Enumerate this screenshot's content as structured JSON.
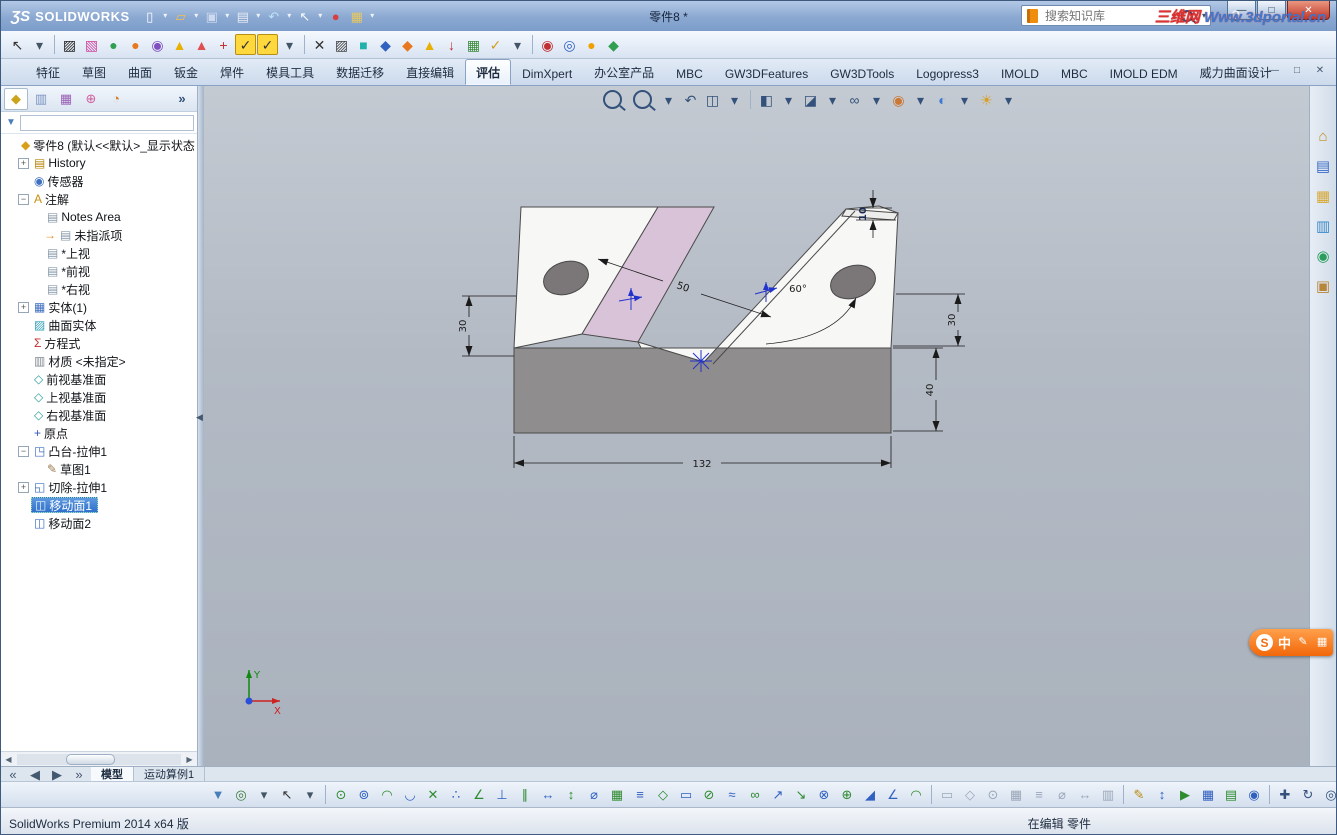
{
  "window": {
    "brand_mark": "ƷS",
    "brand_name": "SOLIDWORKS",
    "title": "零件8 *",
    "search_placeholder": "搜索知识库",
    "help_label": "?",
    "controls": {
      "minimize": "—",
      "maximize": "□",
      "close": "✕"
    },
    "doc_controls": {
      "minimize": "—",
      "restore": "□",
      "close": "✕"
    },
    "collapse_glyph": "◀"
  },
  "colors": {
    "titlebar": "#8aa8d1",
    "viewport_bg": "#b3bac4",
    "selection_blue": "#2e6fc9",
    "ime_orange": "#f2670a"
  },
  "titlebar_icons": [
    {
      "n": "new-document-icon",
      "g": "▯",
      "c": "#fbfdff"
    },
    {
      "n": "new-dropdown-icon",
      "g": "▾",
      "cls": "dd",
      "c": "#eef3fa"
    },
    {
      "n": "open-icon",
      "g": "▱",
      "c": "#f2c14e"
    },
    {
      "n": "open-dropdown-icon",
      "g": "▾",
      "cls": "dd",
      "c": "#eef3fa"
    },
    {
      "n": "save-icon",
      "g": "▣",
      "c": "#cdd9ee"
    },
    {
      "n": "save-dropdown-icon",
      "g": "▾",
      "cls": "dd",
      "c": "#eef3fa"
    },
    {
      "n": "print-icon",
      "g": "▤",
      "c": "#e6ebf3"
    },
    {
      "n": "print-dropdown-icon",
      "g": "▾",
      "cls": "dd",
      "c": "#eef3fa"
    },
    {
      "n": "undo-icon",
      "g": "↶",
      "c": "#bfe3f7"
    },
    {
      "n": "undo-dropdown-icon",
      "g": "▾",
      "cls": "dd",
      "c": "#eef3fa"
    },
    {
      "n": "select-cursor-icon",
      "g": "↖",
      "c": "#f7fafc"
    },
    {
      "n": "select-dropdown-icon",
      "g": "▾",
      "cls": "dd",
      "c": "#eef3fa"
    },
    {
      "n": "rebuild-icon",
      "g": "●",
      "c": "#d84040"
    },
    {
      "n": "options-icon",
      "g": "▦",
      "c": "#e8c860"
    },
    {
      "n": "options-dropdown-icon",
      "g": "▾",
      "cls": "dd",
      "c": "#eef3fa"
    }
  ],
  "toolbar2_icons": [
    {
      "n": "select-tool-icon",
      "g": "↖",
      "c": "#333"
    },
    {
      "n": "select-dropdown-icon",
      "g": "▾",
      "cls": "dd",
      "c": "#456"
    },
    {
      "cls": "sep"
    },
    {
      "n": "zebra-stripes-icon",
      "g": "▨",
      "c": "#222"
    },
    {
      "n": "draft-analysis-icon",
      "g": "▧",
      "c": "#d048a0"
    },
    {
      "n": "curvature-icon",
      "g": "●",
      "c": "#30a050"
    },
    {
      "n": "appearance-ball-icon",
      "g": "●",
      "c": "#e87820"
    },
    {
      "n": "sphere-check-icon",
      "g": "◉",
      "c": "#8050c0"
    },
    {
      "n": "warning-flag-icon",
      "g": "▲",
      "c": "#e8b000"
    },
    {
      "n": "error-flag-icon",
      "g": "▲",
      "c": "#e05050"
    },
    {
      "n": "add-symbol-icon",
      "g": "+",
      "c": "#c03030"
    },
    {
      "n": "check-feature-icon",
      "g": "✓",
      "b": "#ffd83d",
      "c": "#333",
      "cls": "chk"
    },
    {
      "n": "check-sketch-icon",
      "g": "✓",
      "b": "#ffd83d",
      "c": "#333",
      "cls": "chk"
    },
    {
      "n": "check-dropdown-icon",
      "g": "▾",
      "cls": "dd",
      "c": "#456"
    },
    {
      "cls": "sep"
    },
    {
      "n": "deviation-icon",
      "g": "✕",
      "c": "#333"
    },
    {
      "n": "zebra2-icon",
      "g": "▨",
      "c": "#444"
    },
    {
      "n": "thickness-icon",
      "g": "■",
      "c": "#20b2aa"
    },
    {
      "n": "measure-icon",
      "g": "◆",
      "c": "#3060c0"
    },
    {
      "n": "mass-props-icon",
      "g": "◆",
      "c": "#e87820"
    },
    {
      "n": "sensor-warning-icon",
      "g": "▲",
      "c": "#e8b000"
    },
    {
      "n": "import-diag-icon",
      "g": "↓",
      "c": "#c03030"
    },
    {
      "n": "stats-icon",
      "g": "▦",
      "c": "#3a8a3a"
    },
    {
      "n": "verify-icon",
      "g": "✓",
      "c": "#d0a020"
    },
    {
      "n": "verify-dropdown-icon",
      "g": "▾",
      "cls": "dd",
      "c": "#456"
    },
    {
      "cls": "sep"
    },
    {
      "n": "simulation-icon",
      "g": "◉",
      "c": "#c03030"
    },
    {
      "n": "flow-icon",
      "g": "◎",
      "c": "#3060c0"
    },
    {
      "n": "costing-icon",
      "g": "●",
      "c": "#f0a000"
    },
    {
      "n": "sustainability-icon",
      "g": "◆",
      "c": "#30a050"
    }
  ],
  "ribbon": {
    "tabs": [
      {
        "id": "features",
        "label": "特征"
      },
      {
        "id": "sketch",
        "label": "草图"
      },
      {
        "id": "surfaces",
        "label": "曲面"
      },
      {
        "id": "sheet-metal",
        "label": "钣金"
      },
      {
        "id": "weldments",
        "label": "焊件"
      },
      {
        "id": "mold-tools",
        "label": "模具工具"
      },
      {
        "id": "data-migration",
        "label": "数据迁移"
      },
      {
        "id": "direct-editing",
        "label": "直接编辑"
      },
      {
        "id": "evaluate",
        "label": "评估",
        "active": true
      },
      {
        "id": "dimxpert",
        "label": "DimXpert"
      },
      {
        "id": "office-products",
        "label": "办公室产品"
      },
      {
        "id": "mbc",
        "label": "MBC"
      },
      {
        "id": "gw3dfeatures",
        "label": "GW3DFeatures"
      },
      {
        "id": "gw3dtools",
        "label": "GW3DTools"
      },
      {
        "id": "logopress3",
        "label": "Logopress3"
      },
      {
        "id": "imold",
        "label": "IMOLD"
      },
      {
        "id": "mbc-2",
        "label": "MBC"
      },
      {
        "id": "imold-edm",
        "label": "IMOLD EDM"
      },
      {
        "id": "power-surfacing",
        "label": "威力曲面设计"
      }
    ]
  },
  "panel_tabs": [
    {
      "n": "featuremanager-tab-icon",
      "g": "◆",
      "c": "#caa41a",
      "cls": "active"
    },
    {
      "n": "propertymanager-tab-icon",
      "g": "▥",
      "c": "#7a93c0"
    },
    {
      "n": "configurationmanager-tab-icon",
      "g": "▦",
      "c": "#9a5fb5"
    },
    {
      "n": "dimxpertmanager-tab-icon",
      "g": "⊕",
      "c": "#d05fa0"
    },
    {
      "n": "displaymanager-tab-icon",
      "g": "◔",
      "c": "#d07f2a"
    },
    {
      "n": "panel-overflow-chevron-icon",
      "g": "»",
      "c": "#33517a",
      "cls": "chev"
    }
  ],
  "tree": {
    "items": [
      {
        "label": "零件8 (默认<<默认>_显示状态",
        "level": 0,
        "g": "◆",
        "c": "#d8a018",
        "exp": "none",
        "n": "part-icon"
      },
      {
        "label": "History",
        "level": 1,
        "g": "▤",
        "c": "#b8860b",
        "exp": "plus",
        "n": "history-folder-icon"
      },
      {
        "label": "传感器",
        "level": 1,
        "g": "◉",
        "c": "#3f6fbf",
        "exp": "none",
        "n": "sensors-icon"
      },
      {
        "label": "注解",
        "level": 1,
        "g": "A",
        "c": "#c89010",
        "exp": "minus",
        "n": "annotations-icon"
      },
      {
        "label": "Notes Area",
        "level": 2,
        "g": "▤",
        "c": "#8899aa",
        "exp": "none",
        "n": "notes-area-icon"
      },
      {
        "label": "未指派项",
        "level": 2,
        "g": "▤",
        "c": "#8899aa",
        "exp": "none",
        "arrow": true,
        "n": "unassigned-notes-icon"
      },
      {
        "label": "*上视",
        "level": 2,
        "g": "▤",
        "c": "#8899aa",
        "exp": "none",
        "n": "top-view-note-icon"
      },
      {
        "label": "*前视",
        "level": 2,
        "g": "▤",
        "c": "#8899aa",
        "exp": "none",
        "n": "front-view-note-icon"
      },
      {
        "label": "*右视",
        "level": 2,
        "g": "▤",
        "c": "#8899aa",
        "exp": "none",
        "n": "right-view-note-icon"
      },
      {
        "label": "实体(1)",
        "level": 1,
        "g": "▦",
        "c": "#3f6fbf",
        "exp": "plus",
        "n": "solid-bodies-folder-icon"
      },
      {
        "label": "曲面实体",
        "level": 1,
        "g": "▨",
        "c": "#30a0b8",
        "exp": "none",
        "n": "surface-bodies-folder-icon"
      },
      {
        "label": "方程式",
        "level": 1,
        "g": "Σ",
        "c": "#c03030",
        "exp": "none",
        "n": "equations-icon"
      },
      {
        "label": "材质 <未指定>",
        "level": 1,
        "g": "▥",
        "c": "#808890",
        "exp": "none",
        "n": "material-icon"
      },
      {
        "label": "前视基准面",
        "level": 1,
        "g": "◇",
        "c": "#2f9f9f",
        "exp": "none",
        "n": "front-plane-icon"
      },
      {
        "label": "上视基准面",
        "level": 1,
        "g": "◇",
        "c": "#2f9f9f",
        "exp": "none",
        "n": "top-plane-icon"
      },
      {
        "label": "右视基准面",
        "level": 1,
        "g": "◇",
        "c": "#2f9f9f",
        "exp": "none",
        "n": "right-plane-icon"
      },
      {
        "label": "原点",
        "level": 1,
        "g": "+",
        "c": "#3355bb",
        "exp": "none",
        "n": "origin-icon"
      },
      {
        "label": "凸台-拉伸1",
        "level": 1,
        "g": "◳",
        "c": "#3f6fbf",
        "exp": "minus",
        "n": "boss-extrude-icon"
      },
      {
        "label": "草图1",
        "level": 2,
        "g": "✎",
        "c": "#9a7b4f",
        "exp": "none",
        "n": "sketch-icon"
      },
      {
        "label": "切除-拉伸1",
        "level": 1,
        "g": "◱",
        "c": "#3f6fbf",
        "exp": "plus",
        "n": "cut-extrude-icon"
      },
      {
        "label": "移动面1",
        "level": 1,
        "g": "◫",
        "c": "#3f6fbf",
        "exp": "none",
        "selected": true,
        "n": "move-face-icon"
      },
      {
        "label": "移动面2",
        "level": 1,
        "g": "◫",
        "c": "#3f6fbf",
        "exp": "none",
        "n": "move-face-icon"
      }
    ]
  },
  "headsup_icons": [
    {
      "n": "zoom-fit-icon",
      "cls": "mag"
    },
    {
      "n": "zoom-area-icon",
      "cls": "mag"
    },
    {
      "n": "zoom-dropdown-icon",
      "g": "▾",
      "cls": "dd",
      "c": "#33517a"
    },
    {
      "n": "previous-view-icon",
      "g": "↶",
      "c": "#33517a"
    },
    {
      "n": "section-view-icon",
      "g": "◫",
      "c": "#33517a"
    },
    {
      "n": "section-dropdown-icon",
      "g": "▾",
      "cls": "dd",
      "c": "#33517a"
    },
    {
      "cls": "sep"
    },
    {
      "n": "view-orientation-icon",
      "g": "◧",
      "c": "#33517a"
    },
    {
      "n": "orientation-dropdown-icon",
      "g": "▾",
      "cls": "dd",
      "c": "#33517a"
    },
    {
      "n": "display-style-icon",
      "g": "◪",
      "c": "#33517a"
    },
    {
      "n": "display-dropdown-icon",
      "g": "▾",
      "cls": "dd",
      "c": "#33517a"
    },
    {
      "n": "hide-show-items-icon",
      "g": "∞",
      "c": "#33517a"
    },
    {
      "n": "hideshow-dropdown-icon",
      "g": "▾",
      "cls": "dd",
      "c": "#33517a"
    },
    {
      "n": "edit-appearance-icon",
      "g": "◉",
      "c": "#cc7733"
    },
    {
      "n": "appearance-dropdown-icon",
      "g": "▾",
      "cls": "dd",
      "c": "#33517a"
    },
    {
      "n": "apply-scene-icon",
      "g": "◐",
      "c": "#3a7ad0"
    },
    {
      "n": "scene-dropdown-icon",
      "g": "▾",
      "cls": "dd",
      "c": "#33517a"
    },
    {
      "n": "view-settings-icon",
      "g": "☀",
      "c": "#d8a020"
    },
    {
      "n": "viewsettings-dropdown-icon",
      "g": "▾",
      "cls": "dd",
      "c": "#33517a"
    }
  ],
  "right_strip_icons": [
    {
      "n": "solidworks-resources-icon",
      "g": "⌂",
      "c": "#c78c1e"
    },
    {
      "n": "design-library-icon",
      "g": "▤",
      "c": "#3a6bc9"
    },
    {
      "n": "file-explorer-icon",
      "g": "▦",
      "c": "#d8a832"
    },
    {
      "n": "view-palette-icon",
      "g": "▥",
      "c": "#3a8bc9"
    },
    {
      "n": "appearances-scenes-icon",
      "g": "◉",
      "c": "#2a9d5c"
    },
    {
      "n": "custom-properties-icon",
      "g": "▣",
      "c": "#b8863a"
    }
  ],
  "viewport": {
    "dims": {
      "width": "132",
      "left_height": "30",
      "slot": "50",
      "angle": "60°",
      "right_upper": "30",
      "right_lower": "40",
      "step": "10"
    },
    "triad": {
      "x_label": "X",
      "y_label": "Y"
    }
  },
  "model": {
    "face_white": "#f7f7f6",
    "face_dark": "#8f8d8e",
    "face_highlight": "#d9c3d8",
    "hole": "#7b7778",
    "edge": "#4a4a4a",
    "dimension": "#1a1a1a",
    "sketch_accent": "#2233cc"
  },
  "bottom_tabs": {
    "nav_icons": [
      {
        "n": "scroll-first-icon",
        "g": "«",
        "c": "#44586f"
      },
      {
        "n": "scroll-prev-icon",
        "g": "◀",
        "c": "#44586f"
      },
      {
        "n": "scroll-next-icon",
        "g": "▶",
        "c": "#44586f"
      },
      {
        "n": "scroll-last-icon",
        "g": "»",
        "c": "#44586f"
      }
    ],
    "tabs": [
      {
        "id": "model",
        "label": "模型",
        "active": true
      },
      {
        "id": "motion-study-1",
        "label": "运动算例1"
      }
    ]
  },
  "bottom_toolbar_icons": [
    {
      "n": "selection-filter-icon",
      "g": "▼",
      "c": "#4a7ebb"
    },
    {
      "n": "filter-magnify-icon",
      "g": "◎",
      "c": "#3a7a3a"
    },
    {
      "n": "filter-dropdown-icon",
      "g": "▾",
      "cls": "dd",
      "c": "#456"
    },
    {
      "n": "select-tool-icon",
      "g": "↖",
      "c": "#333"
    },
    {
      "n": "select-dropdown-icon",
      "g": "▾",
      "cls": "dd",
      "c": "#456"
    },
    {
      "cls": "sep"
    },
    {
      "n": "snap-point-icon",
      "g": "⊙",
      "c": "#2e8b2e"
    },
    {
      "n": "snap-center-icon",
      "g": "⊚",
      "c": "#3060c0"
    },
    {
      "n": "snap-arc-icon",
      "g": "◠",
      "c": "#2e8b2e"
    },
    {
      "n": "snap-quadrant-icon",
      "g": "◡",
      "c": "#3060c0"
    },
    {
      "n": "snap-intersection-icon",
      "g": "✕",
      "c": "#2e8b2e"
    },
    {
      "n": "snap-nearest-icon",
      "g": "∴",
      "c": "#3060c0"
    },
    {
      "n": "snap-angle-icon",
      "g": "∠",
      "c": "#2e8b2e"
    },
    {
      "n": "snap-perpendicular-icon",
      "g": "⊥",
      "c": "#3060c0"
    },
    {
      "n": "snap-parallel-icon",
      "g": "∥",
      "c": "#2e8b2e"
    },
    {
      "n": "snap-horizontal-icon",
      "g": "↔",
      "c": "#3060c0"
    },
    {
      "n": "snap-vertical-icon",
      "g": "↕",
      "c": "#2e8b2e"
    },
    {
      "n": "snap-diameter-icon",
      "g": "⌀",
      "c": "#3060c0"
    },
    {
      "n": "snap-grid-icon",
      "g": "▦",
      "c": "#2e8b2e"
    },
    {
      "n": "snap-length-icon",
      "g": "≡",
      "c": "#3060c0"
    },
    {
      "n": "snap-shape-icon",
      "g": "◇",
      "c": "#2e8b2e"
    },
    {
      "n": "snap-rect-icon",
      "g": "▭",
      "c": "#3060c0"
    },
    {
      "n": "snap-slot-icon",
      "g": "⊘",
      "c": "#2e8b2e"
    },
    {
      "n": "snap-spline-icon",
      "g": "≈",
      "c": "#3060c0"
    },
    {
      "n": "snap-infinite-icon",
      "g": "∞",
      "c": "#2e8b2e"
    },
    {
      "n": "dim-smart-icon",
      "g": "↗",
      "c": "#3060c0"
    },
    {
      "n": "dim-horizontal-icon",
      "g": "↘",
      "c": "#2e8b2e"
    },
    {
      "n": "dim-baseline-icon",
      "g": "⊗",
      "c": "#3060c0"
    },
    {
      "n": "dim-ordinate-icon",
      "g": "⊕",
      "c": "#2e8b2e"
    },
    {
      "n": "dim-chamfer-icon",
      "g": "◢",
      "c": "#3060c0"
    },
    {
      "n": "dim-angle-icon",
      "g": "∠",
      "c": "#3060c0"
    },
    {
      "n": "dim-arc-icon",
      "g": "◠",
      "c": "#2e8b2e"
    },
    {
      "cls": "sep"
    },
    {
      "n": "relation-tool-icon",
      "g": "▭",
      "c": "#9aa7b8"
    },
    {
      "n": "relation-tool-icon",
      "g": "◇",
      "c": "#9aa7b8"
    },
    {
      "n": "relation-tool-icon",
      "g": "⊙",
      "c": "#9aa7b8"
    },
    {
      "n": "relation-tool-icon",
      "g": "▦",
      "c": "#9aa7b8"
    },
    {
      "n": "relation-tool-icon",
      "g": "≡",
      "c": "#9aa7b8"
    },
    {
      "n": "relation-tool-icon",
      "g": "⌀",
      "c": "#9aa7b8"
    },
    {
      "n": "relation-tool-icon",
      "g": "↔",
      "c": "#9aa7b8"
    },
    {
      "n": "relation-tool-icon",
      "g": "▥",
      "c": "#9aa7b8"
    },
    {
      "cls": "sep"
    },
    {
      "n": "annotation-pencil-icon",
      "g": "✎",
      "c": "#b8860b"
    },
    {
      "n": "quick-dim-icon",
      "g": "↕",
      "c": "#3060c0"
    },
    {
      "n": "macro-icon",
      "g": "▶",
      "c": "#2e8b2e"
    },
    {
      "n": "table-icon",
      "g": "▦",
      "c": "#3060c0"
    },
    {
      "n": "note-icon",
      "g": "▤",
      "c": "#2e8b2e"
    },
    {
      "n": "balloon-icon",
      "g": "◉",
      "c": "#3060c0"
    },
    {
      "cls": "sep"
    },
    {
      "n": "pan-icon",
      "g": "✚",
      "c": "#33517a"
    },
    {
      "n": "rotate-icon",
      "g": "↻",
      "c": "#33517a"
    },
    {
      "n": "zoom-icon",
      "g": "◎",
      "c": "#33517a"
    },
    {
      "n": "fit-icon",
      "g": "⊞",
      "c": "#33517a"
    }
  ],
  "statusbar": {
    "left": "SolidWorks Premium 2014 x64 版",
    "editing": "在编辑 零件",
    "watermark_1": "三维网 ",
    "watermark_2": "Www.3dportal.cn"
  },
  "ime": {
    "brand": "S",
    "mode": "中"
  }
}
